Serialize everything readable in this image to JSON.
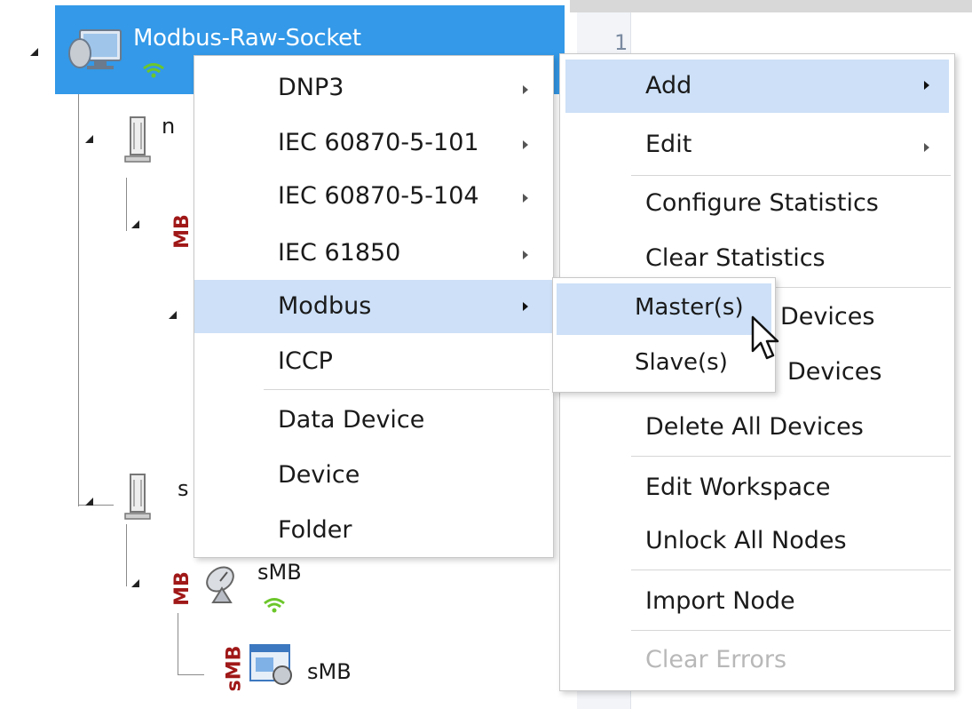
{
  "tree": {
    "root": {
      "label": "Modbus-Raw-Socket"
    },
    "node1_partial": "n",
    "node2_partial": "s",
    "mb_tag": "MB",
    "smb_tag": "sMB",
    "child_label": "sMB",
    "grandchild_label": "sMB"
  },
  "editor": {
    "line_number": "1"
  },
  "protocol_menu": {
    "items": [
      {
        "label": "DNP3"
      },
      {
        "label": "IEC 60870-5-101"
      },
      {
        "label": "IEC 60870-5-104"
      },
      {
        "label": "IEC 61850"
      },
      {
        "label": "Modbus"
      },
      {
        "label": "ICCP"
      },
      {
        "label": "Data Device"
      },
      {
        "label": "Device"
      },
      {
        "label": "Folder"
      }
    ]
  },
  "context_menu": {
    "items": [
      {
        "label": "Add"
      },
      {
        "label": "Edit"
      },
      {
        "label": "Configure Statistics"
      },
      {
        "label": "Clear Statistics"
      },
      {
        "label": "Devices"
      },
      {
        "label": "Devices"
      },
      {
        "label": "Delete All Devices"
      },
      {
        "label": "Edit Workspace"
      },
      {
        "label": "Unlock All Nodes"
      },
      {
        "label": "Import Node"
      },
      {
        "label": "Clear Errors"
      }
    ]
  },
  "modbus_submenu": {
    "items": [
      {
        "label": "Master(s)"
      },
      {
        "label": "Slave(s)"
      }
    ]
  },
  "colors": {
    "selection": "#3399e8",
    "highlight": "#cde0f7",
    "mb_tag": "#a01818",
    "wifi": "#6cc62a"
  }
}
